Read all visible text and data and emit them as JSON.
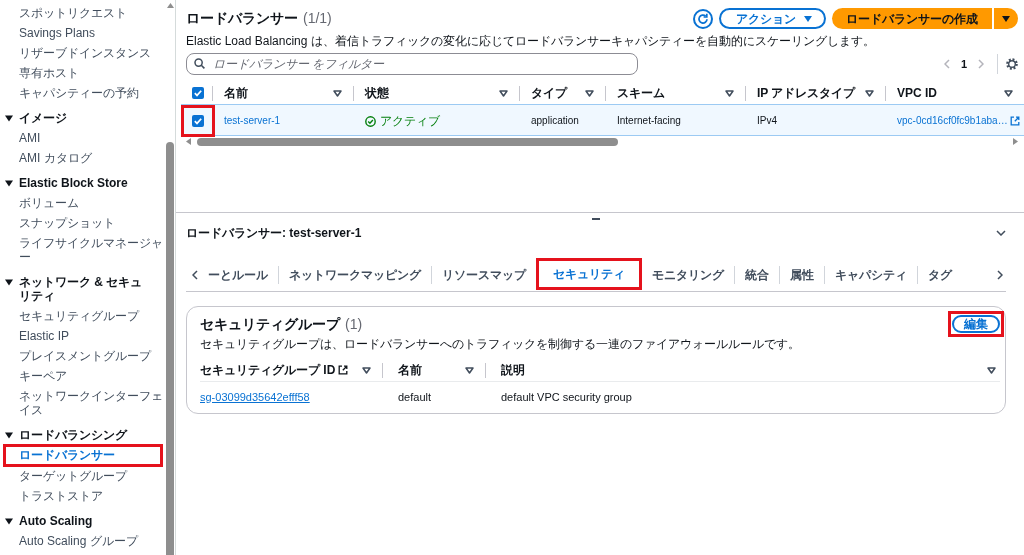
{
  "sidebar": {
    "sections": [
      {
        "items": [
          {
            "label": "スポットリクエスト",
            "selected": false,
            "annotated": false
          },
          {
            "label": "Savings Plans",
            "selected": false,
            "annotated": false
          },
          {
            "label": "リザーブドインスタンス",
            "selected": false,
            "annotated": false
          },
          {
            "label": "専有ホスト",
            "selected": false,
            "annotated": false
          },
          {
            "label": "キャパシティーの予約",
            "selected": false,
            "annotated": false
          }
        ]
      },
      {
        "heading": "イメージ",
        "expanded": true,
        "items": [
          {
            "label": "AMI",
            "selected": false,
            "annotated": false
          },
          {
            "label": "AMI カタログ",
            "selected": false,
            "annotated": false
          }
        ]
      },
      {
        "heading": "Elastic Block Store",
        "expanded": true,
        "items": [
          {
            "label": "ボリューム",
            "selected": false,
            "annotated": false
          },
          {
            "label": "スナップショット",
            "selected": false,
            "annotated": false
          },
          {
            "label": "ライフサイクルマネージャー",
            "selected": false,
            "annotated": false
          }
        ]
      },
      {
        "heading": "ネットワーク & セキュリティ",
        "expanded": true,
        "items": [
          {
            "label": "セキュリティグループ",
            "selected": false,
            "annotated": false
          },
          {
            "label": "Elastic IP",
            "selected": false,
            "annotated": false
          },
          {
            "label": "プレイスメントグループ",
            "selected": false,
            "annotated": false
          },
          {
            "label": "キーペア",
            "selected": false,
            "annotated": false
          },
          {
            "label": "ネットワークインターフェイス",
            "selected": false,
            "annotated": false
          }
        ]
      },
      {
        "heading": "ロードバランシング",
        "expanded": true,
        "items": [
          {
            "label": "ロードバランサー",
            "selected": true,
            "annotated": true
          },
          {
            "label": "ターゲットグループ",
            "selected": false,
            "annotated": false
          },
          {
            "label": "トラストストア",
            "selected": false,
            "annotated": false
          }
        ]
      },
      {
        "heading": "Auto Scaling",
        "expanded": true,
        "items": [
          {
            "label": "Auto Scaling グループ",
            "selected": false,
            "annotated": false
          }
        ]
      }
    ]
  },
  "header": {
    "title": "ロードバランサー",
    "count": "(1/1)",
    "description": "Elastic Load Balancing は、着信トラフィックの変化に応じてロードバランサーキャパシティーを自動的にスケーリングします。",
    "buttons": [
      {
        "kind": "refresh"
      },
      {
        "kind": "dropdown",
        "label": "アクション"
      },
      {
        "kind": "split-primary",
        "label": "ロードバランサーの作成"
      }
    ]
  },
  "filter": {
    "placeholder": "ロードバランサー をフィルター"
  },
  "pagination": {
    "previous_disabled": true,
    "next_disabled": true,
    "pages": [
      {
        "label": "1",
        "selected": true
      }
    ]
  },
  "table": {
    "all_checked": true,
    "columns": [
      {
        "label": "名前"
      },
      {
        "label": "状態"
      },
      {
        "label": "タイプ"
      },
      {
        "label": "スキーム"
      },
      {
        "label": "IP アドレスタイプ"
      },
      {
        "label": "VPC ID"
      }
    ],
    "rows": [
      {
        "selected": true,
        "checked": true,
        "annotated": true,
        "cells": [
          {
            "kind": "link",
            "text": "test-server-1"
          },
          {
            "kind": "status",
            "text": "アクティブ"
          },
          {
            "kind": "text",
            "text": "application"
          },
          {
            "kind": "text",
            "text": "Internet-facing"
          },
          {
            "kind": "text",
            "text": "IPv4"
          },
          {
            "kind": "external-link",
            "text": "vpc-0cd16cf0fc9b1aba…"
          }
        ]
      }
    ]
  },
  "details": {
    "title": "ロードバランサー: test-server-1",
    "tabs": [
      {
        "label": "ーとルール",
        "selected": false,
        "annotated": false
      },
      {
        "label": "ネットワークマッピング",
        "selected": false,
        "annotated": false
      },
      {
        "label": "リソースマップ",
        "selected": false,
        "annotated": false
      },
      {
        "label": "セキュリティ",
        "selected": true,
        "annotated": true
      },
      {
        "label": "モニタリング",
        "selected": false,
        "annotated": false
      },
      {
        "label": "統合",
        "selected": false,
        "annotated": false
      },
      {
        "label": "属性",
        "selected": false,
        "annotated": false
      },
      {
        "label": "キャパシティ",
        "selected": false,
        "annotated": false
      },
      {
        "label": "タグ",
        "selected": false,
        "annotated": false
      }
    ],
    "security_groups": {
      "title": "セキュリティグループ",
      "count": "(1)",
      "description": "セキュリティグループは、ロードバランサーへのトラフィックを制御する一連のファイアウォールルールです。",
      "edit_button": {
        "label": "編集",
        "annotated": true
      },
      "columns": [
        {
          "label": "セキュリティグループ ID",
          "external_link": true
        },
        {
          "label": "名前",
          "external_link": false
        },
        {
          "label": "説明",
          "external_link": false
        }
      ],
      "rows": [
        {
          "cells": [
            {
              "kind": "link",
              "text": "sg-03099d35642efff58"
            },
            {
              "kind": "text",
              "text": "default"
            },
            {
              "kind": "text",
              "text": "default VPC security group"
            }
          ]
        }
      ]
    }
  }
}
